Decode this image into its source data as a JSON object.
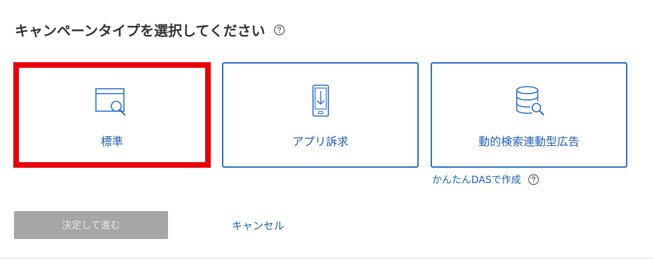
{
  "header": {
    "title": "キャンペーンタイプを選択してください"
  },
  "campaign_types": [
    {
      "label": "標準",
      "icon": "browser-search-icon",
      "selected": true
    },
    {
      "label": "アプリ訴求",
      "icon": "smartphone-download-icon",
      "selected": false
    },
    {
      "label": "動的検索連動型広告",
      "icon": "database-search-icon",
      "selected": false
    }
  ],
  "easy_das_link": "かんたんDASで作成",
  "actions": {
    "decide_label": "決定して進む",
    "cancel_label": "キャンセル"
  },
  "colors": {
    "accent": "#1f5fb6",
    "card_border": "#2a6fc9",
    "selection_highlight": "#e8000b",
    "disabled_button": "#a6a6a6"
  }
}
